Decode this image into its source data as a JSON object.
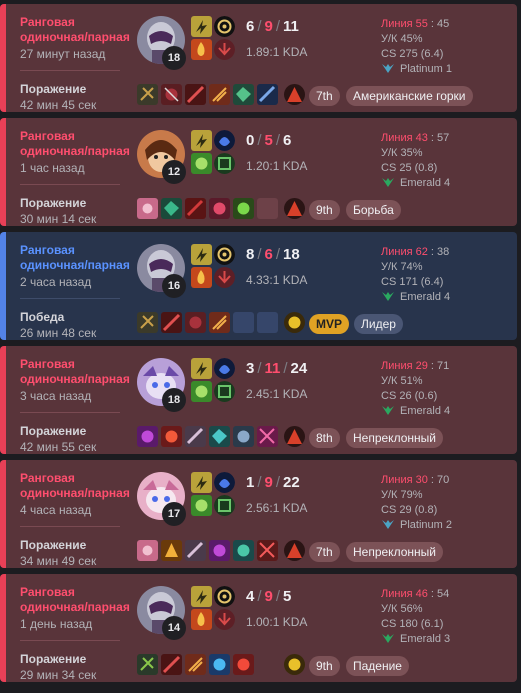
{
  "matches": [
    {
      "outcome": "loss",
      "queue": "Ранговая одиночная/парная",
      "ago": "27 минут назад",
      "result": "Поражение",
      "duration": "42 мин 45 сек",
      "champion_icon": "champion-portrait-purple-mask-icon",
      "level": "18",
      "kills": "6",
      "deaths": "9",
      "assists": "11",
      "kda": "1.89:1 KDA",
      "lane_label": "Линия 55",
      "lane_value": ": 45",
      "kp": "У/К 45%",
      "cs": "CS 275 (6.4)",
      "rank": "Platinum 1",
      "badges": [
        "7th",
        "Американские горки"
      ]
    },
    {
      "outcome": "loss",
      "queue": "Ранговая одиночная/парная",
      "ago": "1 час назад",
      "result": "Поражение",
      "duration": "30 мин 14 сек",
      "champion_icon": "champion-portrait-brown-hair-icon",
      "level": "12",
      "kills": "0",
      "deaths": "5",
      "assists": "6",
      "kda": "1.20:1 KDA",
      "lane_label": "Линия 43",
      "lane_value": ": 57",
      "kp": "У/К 35%",
      "cs": "CS 25 (0.8)",
      "rank": "Emerald 4",
      "badges": [
        "9th",
        "Борьба"
      ]
    },
    {
      "outcome": "win",
      "queue": "Ранговая одиночная/парная",
      "ago": "2 часа назад",
      "result": "Победа",
      "duration": "26 мин 48 сек",
      "champion_icon": "champion-portrait-purple-mask-icon",
      "level": "16",
      "kills": "8",
      "deaths": "6",
      "assists": "18",
      "kda": "4.33:1 KDA",
      "lane_label": "Линия 62",
      "lane_value": ": 38",
      "kp": "У/К 74%",
      "cs": "CS 171 (6.4)",
      "rank": "Emerald 4",
      "badges": [
        "MVP",
        "Лидер"
      ]
    },
    {
      "outcome": "loss",
      "queue": "Ранговая одиночная/парная",
      "ago": "3 часа назад",
      "result": "Поражение",
      "duration": "42 мин 55 сек",
      "champion_icon": "champion-portrait-yordle-icon",
      "level": "18",
      "kills": "3",
      "deaths": "11",
      "assists": "24",
      "kda": "2.45:1 KDA",
      "lane_label": "Линия 29",
      "lane_value": ": 71",
      "kp": "У/К 51%",
      "cs": "CS 26 (0.6)",
      "rank": "Emerald 4",
      "badges": [
        "8th",
        "Непреклонный"
      ]
    },
    {
      "outcome": "loss",
      "queue": "Ранговая одиночная/парная",
      "ago": "4 часа назад",
      "result": "Поражение",
      "duration": "34 мин 49 сек",
      "champion_icon": "champion-portrait-yordle-icon",
      "level": "17",
      "kills": "1",
      "deaths": "9",
      "assists": "22",
      "kda": "2.56:1 KDA",
      "lane_label": "Линия 30",
      "lane_value": ": 70",
      "kp": "У/К 79%",
      "cs": "CS 29 (0.8)",
      "rank": "Platinum 2",
      "badges": [
        "7th",
        "Непреклонный"
      ]
    },
    {
      "outcome": "loss",
      "queue": "Ранговая одиночная/парная",
      "ago": "1 день назад",
      "result": "Поражение",
      "duration": "29 мин 34 сек",
      "champion_icon": "champion-portrait-purple-mask-icon",
      "level": "14",
      "kills": "4",
      "deaths": "9",
      "assists": "5",
      "kda": "1.00:1 KDA",
      "lane_label": "Линия 46",
      "lane_value": ": 54",
      "kp": "У/К 56%",
      "cs": "CS 180 (6.1)",
      "rank": "Emerald 3",
      "badges": [
        "9th",
        "Падение"
      ]
    }
  ],
  "colors": {
    "loss_bg": "#59343a",
    "win_bg": "#28344c",
    "loss_accent": "#ff4e6e",
    "win_accent": "#5a92ff",
    "mvp": "#e0a224"
  }
}
